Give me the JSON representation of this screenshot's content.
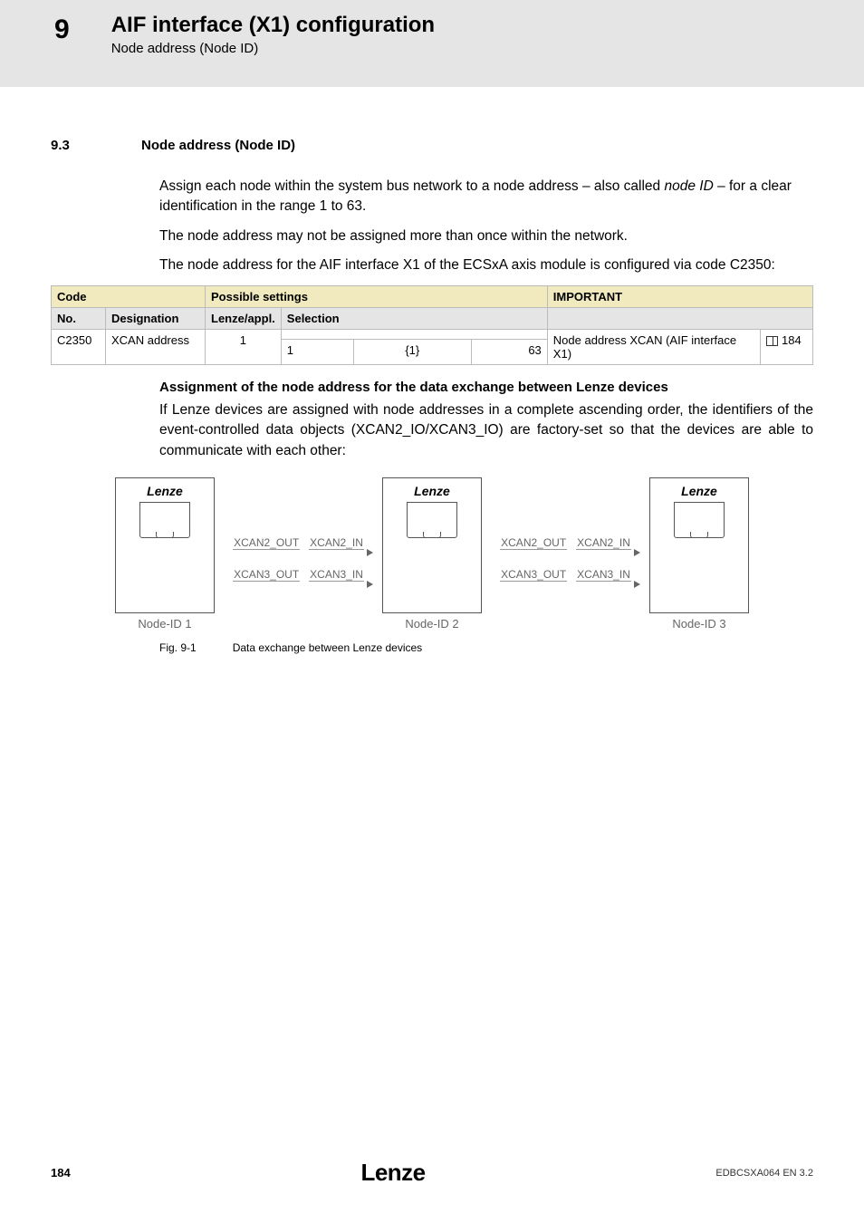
{
  "header": {
    "chapter_number": "9",
    "chapter_title": "AIF interface (X1) configuration",
    "subtitle": "Node address (Node ID)"
  },
  "section": {
    "number": "9.3",
    "title": "Node address (Node ID)"
  },
  "paragraphs": {
    "p1a": "Assign each node within the system bus network to a node address  – also called ",
    "p1b": "node ID",
    "p1c": " – for a clear identification in the range 1 to 63.",
    "p2": "The node address may not be assigned more than once within the network.",
    "p3": "The node address for the AIF interface X1 of the  ECSxA axis module is configured via code C2350:"
  },
  "table": {
    "head": {
      "code": "Code",
      "possible": "Possible settings",
      "important": "IMPORTANT",
      "no": "No.",
      "designation": "Designation",
      "lenze": "Lenze/appl.",
      "selection": "Selection"
    },
    "row": {
      "no": "C2350",
      "designation": "XCAN address",
      "lenze": "1",
      "sel_min": "1",
      "sel_step": "{1}",
      "sel_max": "63",
      "important": "Node address XCAN (AIF interface X1)",
      "ref": "184"
    }
  },
  "assignment": {
    "title": "Assignment of the node address for the data exchange between Lenze devices",
    "para": "If Lenze devices are assigned with node addresses in a complete ascending order, the identifiers of the event‑controlled data objects (XCAN2_IO/XCAN3_IO) are factory‑set so that the devices are able to communicate with each other:"
  },
  "diagram": {
    "brand": "Lenze",
    "node1": "Node-ID 1",
    "node2": "Node-ID 2",
    "node3": "Node-ID 3",
    "x2out": "XCAN2_OUT",
    "x2in": "XCAN2_IN",
    "x3out": "XCAN3_OUT",
    "x3in": "XCAN3_IN"
  },
  "figure": {
    "id": "Fig. 9-1",
    "caption": "Data exchange between Lenze devices"
  },
  "footer": {
    "page": "184",
    "logo": "Lenze",
    "doc": "EDBCSXA064 EN  3.2"
  }
}
